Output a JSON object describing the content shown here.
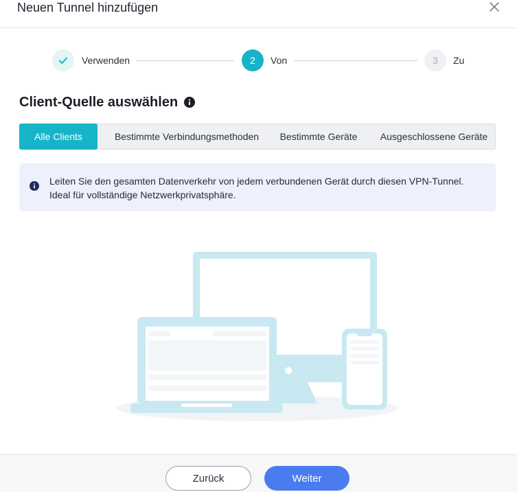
{
  "dialog": {
    "title": "Neuen Tunnel hinzufügen",
    "close_icon": "close-icon"
  },
  "stepper": {
    "steps": [
      {
        "number": "1",
        "label": "Verwenden",
        "state": "done"
      },
      {
        "number": "2",
        "label": "Von",
        "state": "active"
      },
      {
        "number": "3",
        "label": "Zu",
        "state": "todo"
      }
    ]
  },
  "section": {
    "title": "Client-Quelle auswählen",
    "icon": "info-icon"
  },
  "tabs": [
    {
      "label": "Alle Clients",
      "active": true
    },
    {
      "label": "Bestimmte Verbindungsmethoden",
      "active": false
    },
    {
      "label": "Bestimmte Geräte",
      "active": false
    },
    {
      "label": "Ausgeschlossene Geräte",
      "active": false
    }
  ],
  "notice": {
    "line1": "Leiten Sie den gesamten Datenverkehr von jedem verbundenen Gerät durch diesen VPN-Tunnel.",
    "line2": "Ideal für vollständige Netzwerkprivatsphäre."
  },
  "footer": {
    "back_label": "Zurück",
    "next_label": "Weiter"
  },
  "colors": {
    "accent": "#16b4c8",
    "primary_button": "#4a7cf0",
    "notice_bg": "#eef1fb",
    "illustration": "#c8e9f1"
  }
}
